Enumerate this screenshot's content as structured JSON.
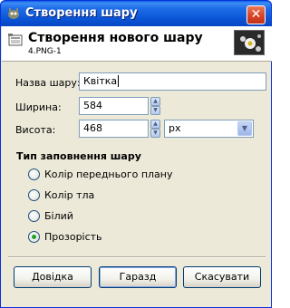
{
  "window": {
    "title": "Створення шару"
  },
  "header": {
    "title": "Створення нового шару",
    "subtitle": "4.PNG-1"
  },
  "form": {
    "name_label": "Назва шару:",
    "name_value": "Квітка",
    "width_label": "Ширина:",
    "width_value": "584",
    "height_label": "Висота:",
    "height_value": "468",
    "unit_value": "px"
  },
  "fill": {
    "title": "Тип заповнення шару",
    "options": [
      {
        "label": "Колір переднього плану",
        "checked": false
      },
      {
        "label": "Колір тла",
        "checked": false
      },
      {
        "label": "Білий",
        "checked": false
      },
      {
        "label": "Прозорість",
        "checked": true
      }
    ]
  },
  "buttons": {
    "help": "Довідка",
    "ok": "Гаразд",
    "cancel": "Скасувати"
  },
  "colors": {
    "titlebar": "#0a55d6",
    "window_bg": "#ece9d8",
    "radio_check": "#21a121"
  }
}
